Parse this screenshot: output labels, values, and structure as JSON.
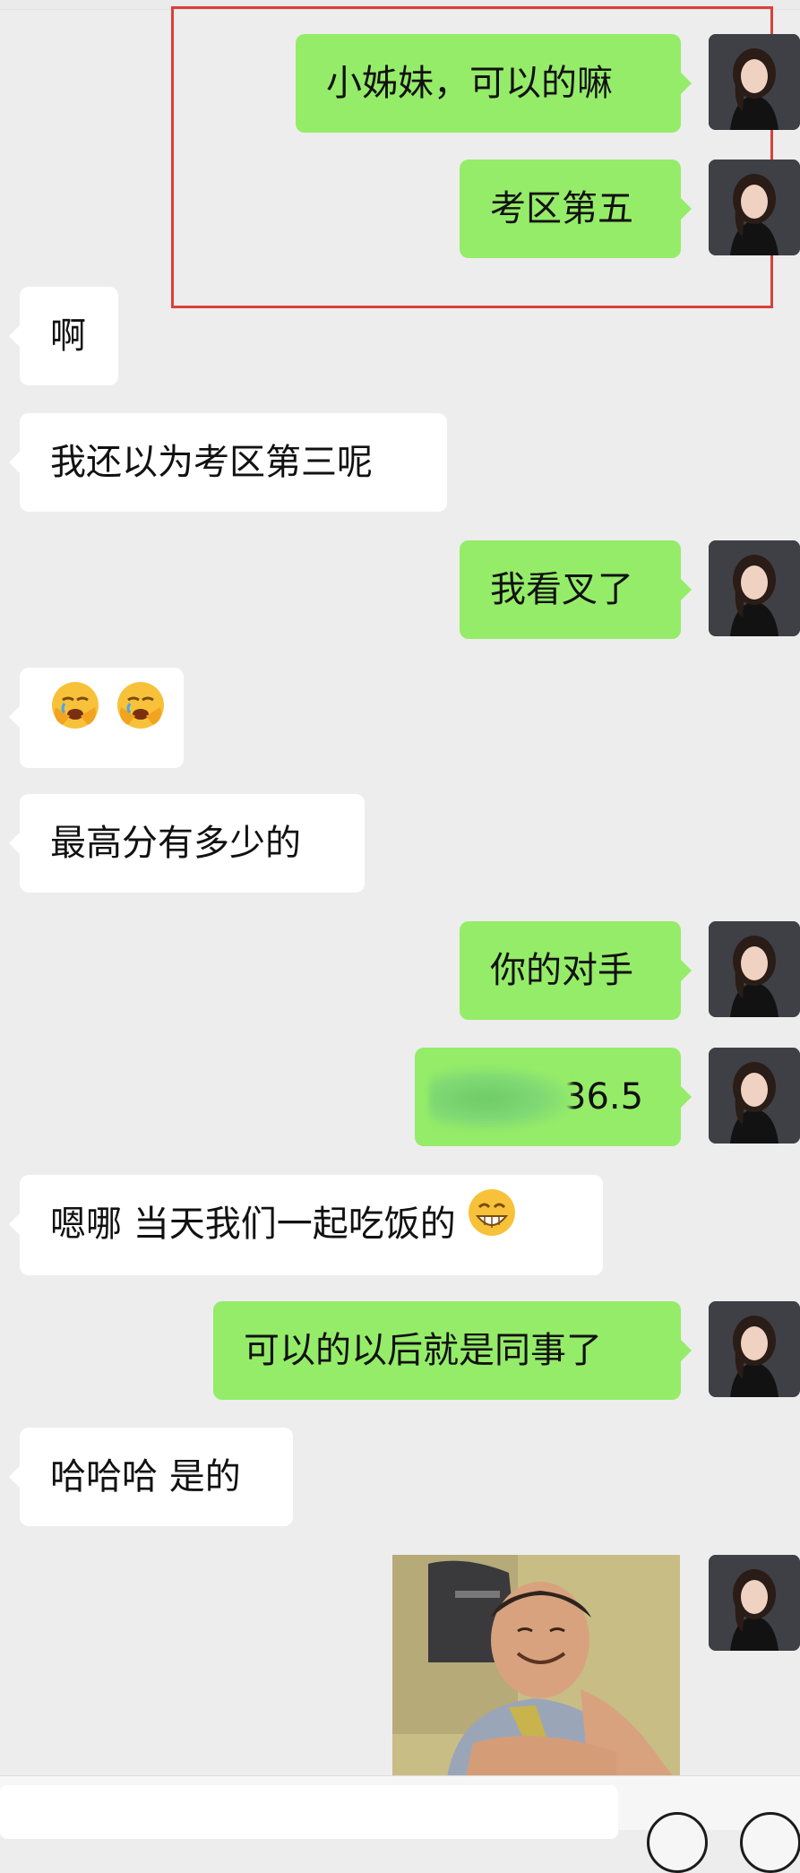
{
  "messages": [
    {
      "side": "out",
      "text": "小姊妹，可以的嘛"
    },
    {
      "side": "out",
      "text": "考区第五"
    },
    {
      "side": "in",
      "text": "啊"
    },
    {
      "side": "in",
      "text": "我还以为考区第三呢"
    },
    {
      "side": "out",
      "text": "我看叉了"
    },
    {
      "side": "in",
      "text": "",
      "emoji": [
        "face-palm-icon",
        "face-palm-icon"
      ]
    },
    {
      "side": "in",
      "text": "最高分有多少的"
    },
    {
      "side": "out",
      "text": "你的对手"
    },
    {
      "side": "out",
      "text": "36.5",
      "note_blurred_prefix": true
    },
    {
      "side": "in",
      "text": "嗯哪  当天我们一起吃饭的",
      "emoji_suffix": "grin-icon"
    },
    {
      "side": "out",
      "text": "可以的以后就是同事了"
    },
    {
      "side": "in",
      "text": "哈哈哈 是的"
    },
    {
      "side": "out",
      "type": "image"
    }
  ],
  "colors": {
    "background": "#ededed",
    "bubble_out": "#95ec69",
    "bubble_in": "#ffffff",
    "highlight_border": "#d9413a"
  }
}
